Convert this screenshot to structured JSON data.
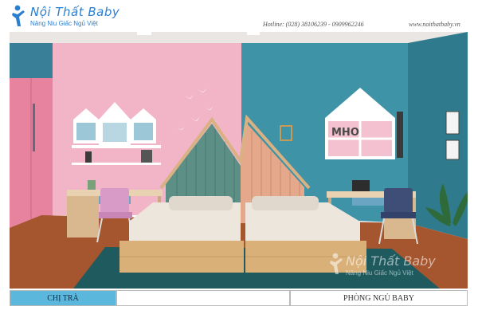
{
  "brand": {
    "title": "Nội Thất Baby",
    "slogan": "Nâng Niu Giấc Ngủ Việt",
    "accent": "#2a7fd0"
  },
  "contact": {
    "hotline": "Hotline: (028) 38106239  -  0909962246",
    "website": "www.noithatbaby.vn"
  },
  "watermark": {
    "title": "Nội Thất Baby",
    "slogan": "Nâng Niu Giấc Ngủ Việt"
  },
  "footer": {
    "left_label": "CHỊ TRÀ",
    "right_label": "PHÒNG NGỦ BABY",
    "left_color": "#5bb8dc"
  },
  "scene": {
    "shelf_letters": "MHO",
    "colors": {
      "pink_wall": "#f2b5c8",
      "blue_wall": "#3f93a6",
      "floor": "#a5562e",
      "rug": "#1e5a5e"
    }
  }
}
